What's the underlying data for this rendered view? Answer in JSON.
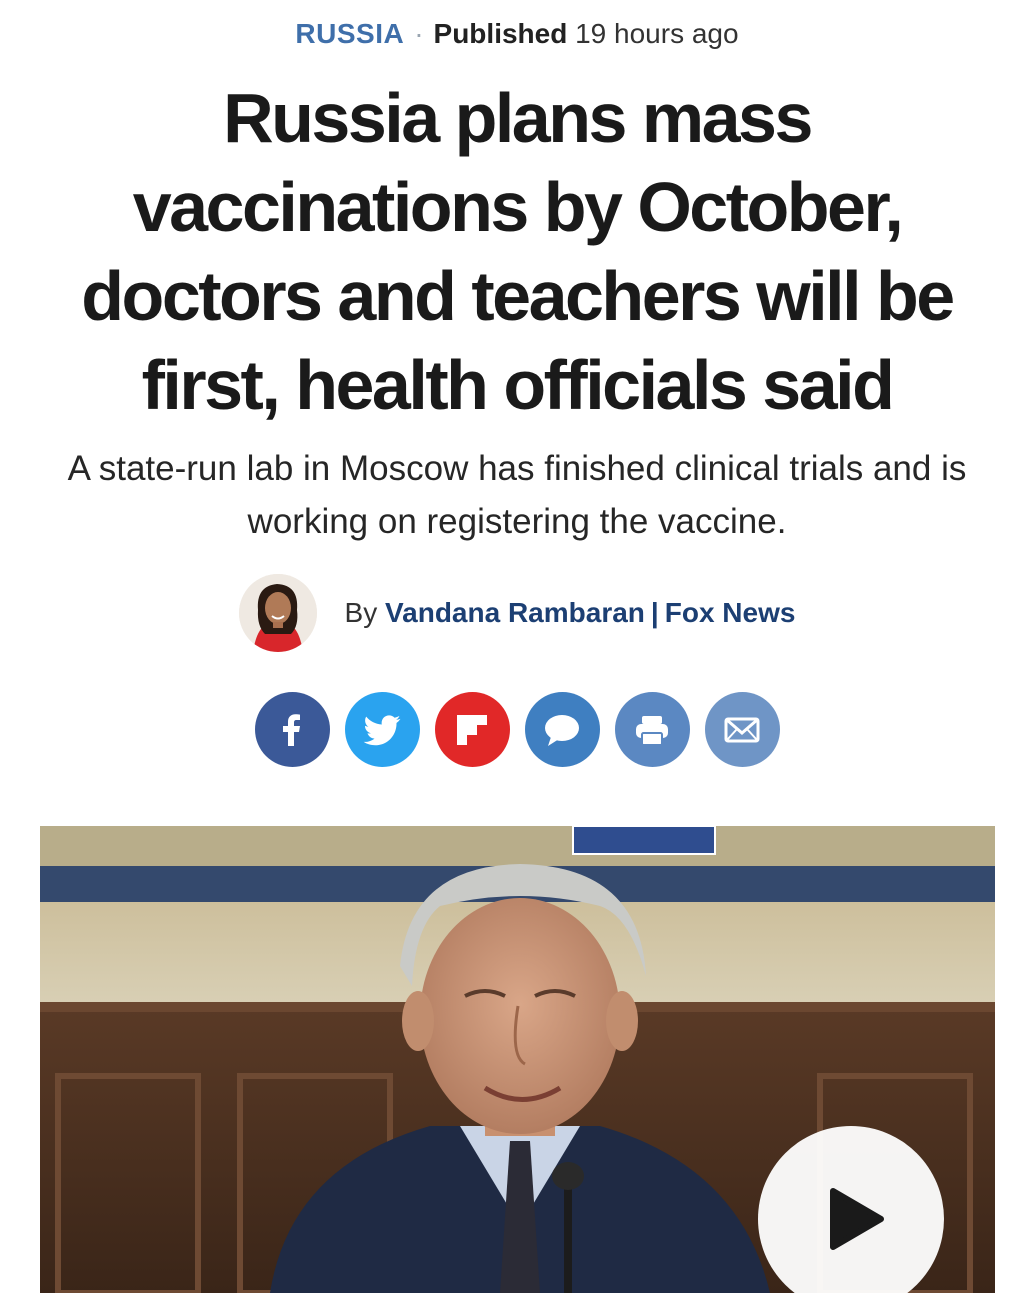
{
  "meta": {
    "category": "RUSSIA",
    "separator": "·",
    "published_label": "Published",
    "published_time": "19 hours ago"
  },
  "headline": "Russia plans mass vaccinations by October, doctors and teachers will be first, health officials said",
  "dek": "A state-run lab in Moscow has finished clinical trials and is working on registering the vaccine.",
  "byline": {
    "prefix": "By",
    "author": "Vandana Rambaran",
    "separator": "|",
    "outlet": "Fox News"
  },
  "share": [
    {
      "icon": "facebook-icon",
      "color": "#3b5998"
    },
    {
      "icon": "twitter-icon",
      "color": "#2aa3ef"
    },
    {
      "icon": "flipboard-icon",
      "color": "#e12828"
    },
    {
      "icon": "comment-icon",
      "color": "#3f7fc1"
    },
    {
      "icon": "print-icon",
      "color": "#5b88c2"
    },
    {
      "icon": "email-icon",
      "color": "#6f95c6"
    }
  ],
  "video": {
    "play_icon": "play-icon"
  }
}
